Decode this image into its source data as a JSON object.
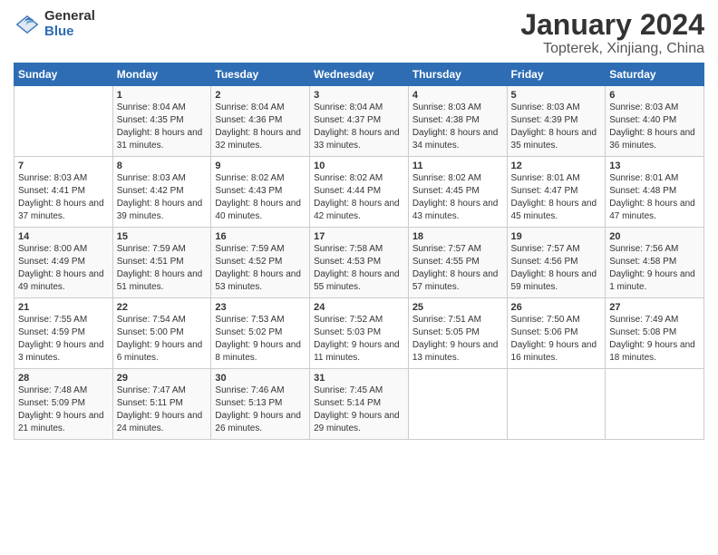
{
  "header": {
    "logo_general": "General",
    "logo_blue": "Blue",
    "title": "January 2024",
    "subtitle": "Topterek, Xinjiang, China"
  },
  "days_of_week": [
    "Sunday",
    "Monday",
    "Tuesday",
    "Wednesday",
    "Thursday",
    "Friday",
    "Saturday"
  ],
  "weeks": [
    [
      {
        "day": "",
        "sunrise": "",
        "sunset": "",
        "daylight": ""
      },
      {
        "day": "1",
        "sunrise": "Sunrise: 8:04 AM",
        "sunset": "Sunset: 4:35 PM",
        "daylight": "Daylight: 8 hours and 31 minutes."
      },
      {
        "day": "2",
        "sunrise": "Sunrise: 8:04 AM",
        "sunset": "Sunset: 4:36 PM",
        "daylight": "Daylight: 8 hours and 32 minutes."
      },
      {
        "day": "3",
        "sunrise": "Sunrise: 8:04 AM",
        "sunset": "Sunset: 4:37 PM",
        "daylight": "Daylight: 8 hours and 33 minutes."
      },
      {
        "day": "4",
        "sunrise": "Sunrise: 8:03 AM",
        "sunset": "Sunset: 4:38 PM",
        "daylight": "Daylight: 8 hours and 34 minutes."
      },
      {
        "day": "5",
        "sunrise": "Sunrise: 8:03 AM",
        "sunset": "Sunset: 4:39 PM",
        "daylight": "Daylight: 8 hours and 35 minutes."
      },
      {
        "day": "6",
        "sunrise": "Sunrise: 8:03 AM",
        "sunset": "Sunset: 4:40 PM",
        "daylight": "Daylight: 8 hours and 36 minutes."
      }
    ],
    [
      {
        "day": "7",
        "sunrise": "Sunrise: 8:03 AM",
        "sunset": "Sunset: 4:41 PM",
        "daylight": "Daylight: 8 hours and 37 minutes."
      },
      {
        "day": "8",
        "sunrise": "Sunrise: 8:03 AM",
        "sunset": "Sunset: 4:42 PM",
        "daylight": "Daylight: 8 hours and 39 minutes."
      },
      {
        "day": "9",
        "sunrise": "Sunrise: 8:02 AM",
        "sunset": "Sunset: 4:43 PM",
        "daylight": "Daylight: 8 hours and 40 minutes."
      },
      {
        "day": "10",
        "sunrise": "Sunrise: 8:02 AM",
        "sunset": "Sunset: 4:44 PM",
        "daylight": "Daylight: 8 hours and 42 minutes."
      },
      {
        "day": "11",
        "sunrise": "Sunrise: 8:02 AM",
        "sunset": "Sunset: 4:45 PM",
        "daylight": "Daylight: 8 hours and 43 minutes."
      },
      {
        "day": "12",
        "sunrise": "Sunrise: 8:01 AM",
        "sunset": "Sunset: 4:47 PM",
        "daylight": "Daylight: 8 hours and 45 minutes."
      },
      {
        "day": "13",
        "sunrise": "Sunrise: 8:01 AM",
        "sunset": "Sunset: 4:48 PM",
        "daylight": "Daylight: 8 hours and 47 minutes."
      }
    ],
    [
      {
        "day": "14",
        "sunrise": "Sunrise: 8:00 AM",
        "sunset": "Sunset: 4:49 PM",
        "daylight": "Daylight: 8 hours and 49 minutes."
      },
      {
        "day": "15",
        "sunrise": "Sunrise: 7:59 AM",
        "sunset": "Sunset: 4:51 PM",
        "daylight": "Daylight: 8 hours and 51 minutes."
      },
      {
        "day": "16",
        "sunrise": "Sunrise: 7:59 AM",
        "sunset": "Sunset: 4:52 PM",
        "daylight": "Daylight: 8 hours and 53 minutes."
      },
      {
        "day": "17",
        "sunrise": "Sunrise: 7:58 AM",
        "sunset": "Sunset: 4:53 PM",
        "daylight": "Daylight: 8 hours and 55 minutes."
      },
      {
        "day": "18",
        "sunrise": "Sunrise: 7:57 AM",
        "sunset": "Sunset: 4:55 PM",
        "daylight": "Daylight: 8 hours and 57 minutes."
      },
      {
        "day": "19",
        "sunrise": "Sunrise: 7:57 AM",
        "sunset": "Sunset: 4:56 PM",
        "daylight": "Daylight: 8 hours and 59 minutes."
      },
      {
        "day": "20",
        "sunrise": "Sunrise: 7:56 AM",
        "sunset": "Sunset: 4:58 PM",
        "daylight": "Daylight: 9 hours and 1 minute."
      }
    ],
    [
      {
        "day": "21",
        "sunrise": "Sunrise: 7:55 AM",
        "sunset": "Sunset: 4:59 PM",
        "daylight": "Daylight: 9 hours and 3 minutes."
      },
      {
        "day": "22",
        "sunrise": "Sunrise: 7:54 AM",
        "sunset": "Sunset: 5:00 PM",
        "daylight": "Daylight: 9 hours and 6 minutes."
      },
      {
        "day": "23",
        "sunrise": "Sunrise: 7:53 AM",
        "sunset": "Sunset: 5:02 PM",
        "daylight": "Daylight: 9 hours and 8 minutes."
      },
      {
        "day": "24",
        "sunrise": "Sunrise: 7:52 AM",
        "sunset": "Sunset: 5:03 PM",
        "daylight": "Daylight: 9 hours and 11 minutes."
      },
      {
        "day": "25",
        "sunrise": "Sunrise: 7:51 AM",
        "sunset": "Sunset: 5:05 PM",
        "daylight": "Daylight: 9 hours and 13 minutes."
      },
      {
        "day": "26",
        "sunrise": "Sunrise: 7:50 AM",
        "sunset": "Sunset: 5:06 PM",
        "daylight": "Daylight: 9 hours and 16 minutes."
      },
      {
        "day": "27",
        "sunrise": "Sunrise: 7:49 AM",
        "sunset": "Sunset: 5:08 PM",
        "daylight": "Daylight: 9 hours and 18 minutes."
      }
    ],
    [
      {
        "day": "28",
        "sunrise": "Sunrise: 7:48 AM",
        "sunset": "Sunset: 5:09 PM",
        "daylight": "Daylight: 9 hours and 21 minutes."
      },
      {
        "day": "29",
        "sunrise": "Sunrise: 7:47 AM",
        "sunset": "Sunset: 5:11 PM",
        "daylight": "Daylight: 9 hours and 24 minutes."
      },
      {
        "day": "30",
        "sunrise": "Sunrise: 7:46 AM",
        "sunset": "Sunset: 5:13 PM",
        "daylight": "Daylight: 9 hours and 26 minutes."
      },
      {
        "day": "31",
        "sunrise": "Sunrise: 7:45 AM",
        "sunset": "Sunset: 5:14 PM",
        "daylight": "Daylight: 9 hours and 29 minutes."
      },
      {
        "day": "",
        "sunrise": "",
        "sunset": "",
        "daylight": ""
      },
      {
        "day": "",
        "sunrise": "",
        "sunset": "",
        "daylight": ""
      },
      {
        "day": "",
        "sunrise": "",
        "sunset": "",
        "daylight": ""
      }
    ]
  ]
}
